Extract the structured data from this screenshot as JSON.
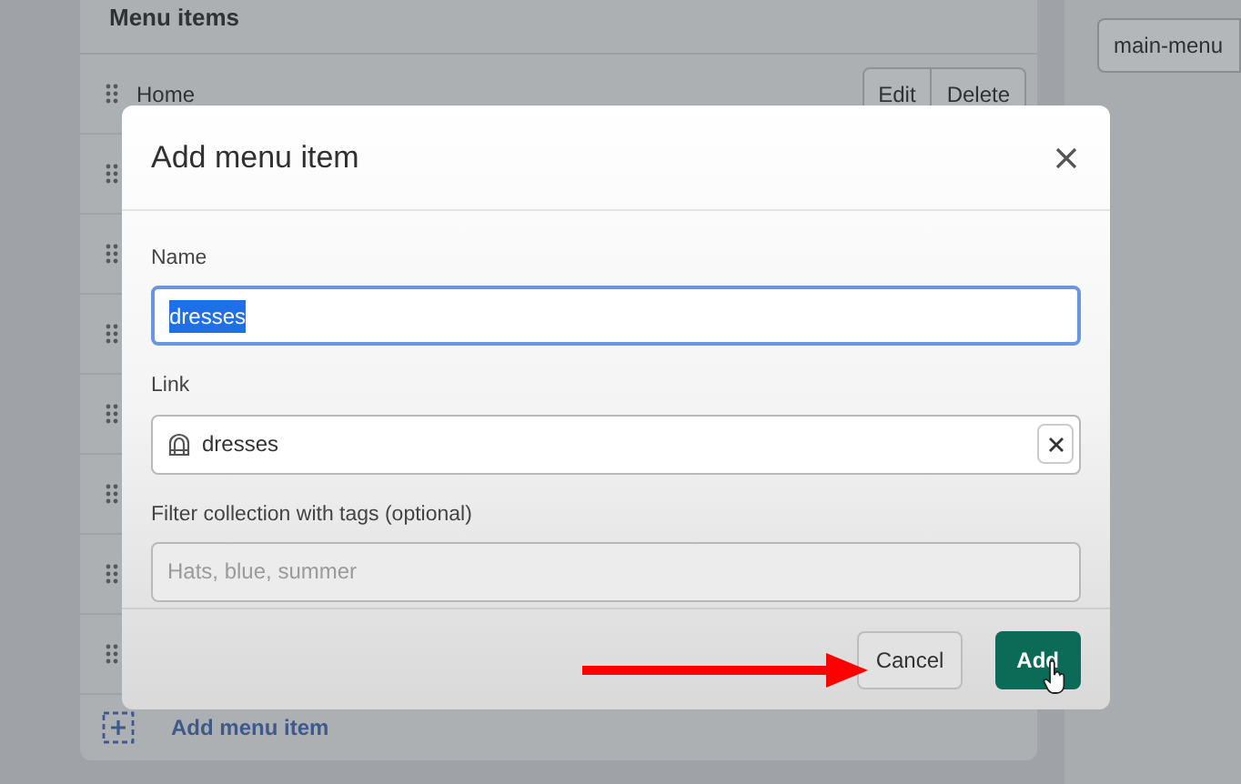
{
  "menu_card": {
    "title": "Menu items",
    "rows": [
      {
        "kind": "item",
        "label": "Home",
        "actions": [
          "Edit",
          "Delete"
        ]
      },
      {
        "kind": "covered"
      },
      {
        "kind": "covered"
      },
      {
        "kind": "covered"
      },
      {
        "kind": "covered"
      },
      {
        "kind": "covered"
      },
      {
        "kind": "covered"
      },
      {
        "kind": "covered"
      }
    ],
    "add_link": "Add menu item"
  },
  "handle_field": {
    "value": "main-menu"
  },
  "dialog": {
    "title": "Add menu item",
    "fields": [
      {
        "kind": "text",
        "label": "Name",
        "value": "dresses",
        "focused": true,
        "selected_text": true
      },
      {
        "kind": "link",
        "label": "Link",
        "value": "dresses"
      },
      {
        "kind": "text",
        "label": "Filter collection with tags (optional)",
        "placeholder": "Hats, blue, summer",
        "disabled": true
      }
    ],
    "buttons": [
      {
        "kind": "secondary",
        "label": "Cancel"
      },
      {
        "kind": "primary",
        "label": "Add"
      }
    ]
  },
  "annotation": {
    "kind": "arrow"
  }
}
